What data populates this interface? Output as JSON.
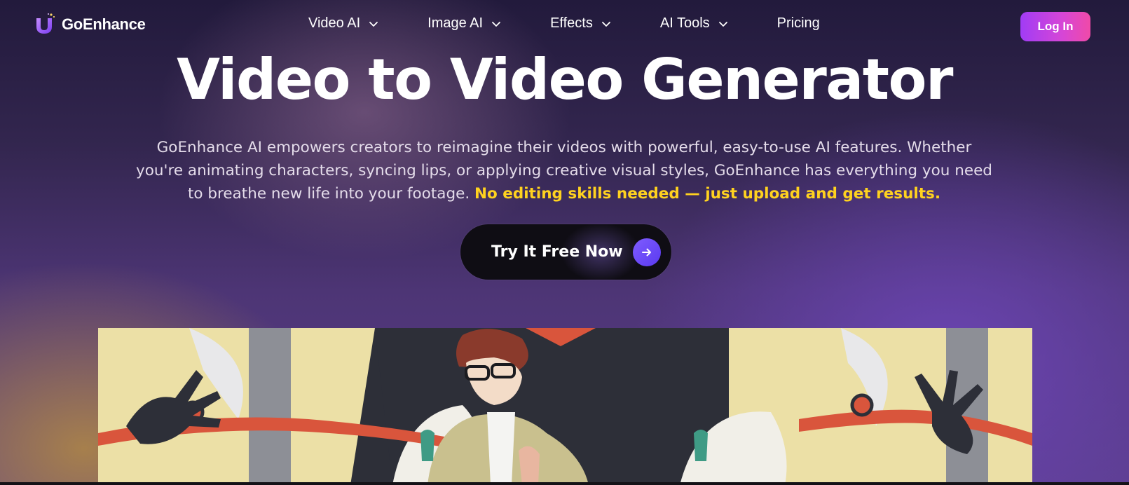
{
  "brand": {
    "name": "GoEnhance"
  },
  "nav": {
    "items": [
      {
        "label": "Video AI",
        "has_dropdown": true
      },
      {
        "label": "Image AI",
        "has_dropdown": true
      },
      {
        "label": "Effects",
        "has_dropdown": true
      },
      {
        "label": "AI Tools",
        "has_dropdown": true
      },
      {
        "label": "Pricing",
        "has_dropdown": false
      }
    ],
    "login_label": "Log In"
  },
  "hero": {
    "title": "Video to Video Generator",
    "description": "GoEnhance AI empowers creators to reimagine their videos with powerful, easy-to-use AI features. Whether you're animating characters, syncing lips, or applying creative visual styles, GoEnhance has everything you need to breathe new life into your footage.",
    "highlight": "No editing skills needed — just upload and get results.",
    "cta_label": "Try It Free Now"
  },
  "icons": {
    "logo": "goenhance-logo-icon",
    "dropdown": "chevron-down-icon",
    "cta": "arrow-right-icon"
  },
  "colors": {
    "accent_purple": "#7f5cff",
    "login_gradient_start": "#a13cf5",
    "login_gradient_end": "#f04aa8",
    "highlight_yellow": "#ffd21f"
  }
}
